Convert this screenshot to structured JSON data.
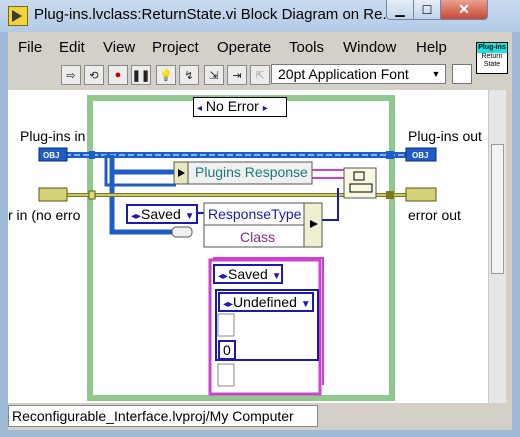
{
  "window": {
    "title": "Plug-ins.lvclass:ReturnState.vi Block Diagram on Re..."
  },
  "menu": [
    "File",
    "Edit",
    "View",
    "Project",
    "Operate",
    "Tools",
    "Window",
    "Help"
  ],
  "toolbar": {
    "font": "20pt Application Font"
  },
  "vi_icon": {
    "line1": "Plug-ins",
    "line2": "Return",
    "line3": "State"
  },
  "diagram": {
    "case_selector": "No Error",
    "left_labels": {
      "plugins_in": "Plug-ins in",
      "error_in": "r in (no erro"
    },
    "right_labels": {
      "plugins_out": "Plug-ins out",
      "error_out": "error out"
    },
    "terminal_obj": "OBJ",
    "unbundle_label": "Plugins Response",
    "saved_const": "Saved",
    "responsetype": "ResponseType",
    "class": "Class",
    "inner_case": {
      "selector": "Saved",
      "undefined": "Undefined",
      "value": "0"
    }
  },
  "status": "Reconfigurable_Interface.lvproj/My Computer"
}
